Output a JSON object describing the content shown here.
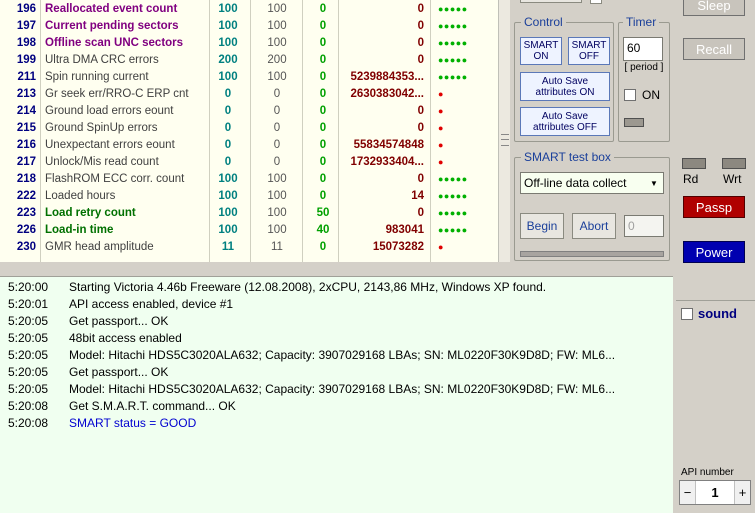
{
  "smart_rows": [
    {
      "id": "196",
      "name": "Reallocated event count",
      "val": "100",
      "worst": "100",
      "thr": "0",
      "raw": "0",
      "health": "●●●●●",
      "style": "purple",
      "hc": "green"
    },
    {
      "id": "197",
      "name": "Current pending sectors",
      "val": "100",
      "worst": "100",
      "thr": "0",
      "raw": "0",
      "health": "●●●●●",
      "style": "purple",
      "hc": "green"
    },
    {
      "id": "198",
      "name": "Offline scan UNC sectors",
      "val": "100",
      "worst": "100",
      "thr": "0",
      "raw": "0",
      "health": "●●●●●",
      "style": "purple",
      "hc": "green"
    },
    {
      "id": "199",
      "name": "Ultra DMA CRC errors",
      "val": "200",
      "worst": "200",
      "thr": "0",
      "raw": "0",
      "health": "●●●●●",
      "style": "gray",
      "hc": "green"
    },
    {
      "id": "211",
      "name": "Spin running current",
      "val": "100",
      "worst": "100",
      "thr": "0",
      "raw": "5239884353...",
      "health": "●●●●●",
      "style": "gray",
      "hc": "green"
    },
    {
      "id": "213",
      "name": "Gr seek err/RRO-C ERP cnt",
      "val": "0",
      "worst": "0",
      "thr": "0",
      "raw": "2630383042...",
      "health": "●",
      "style": "gray",
      "hc": "red"
    },
    {
      "id": "214",
      "name": "Ground load errors eount",
      "val": "0",
      "worst": "0",
      "thr": "0",
      "raw": "0",
      "health": "●",
      "style": "gray",
      "hc": "red"
    },
    {
      "id": "215",
      "name": "Ground SpinUp errors",
      "val": "0",
      "worst": "0",
      "thr": "0",
      "raw": "0",
      "health": "●",
      "style": "gray",
      "hc": "red"
    },
    {
      "id": "216",
      "name": "Unexpectant errors eount",
      "val": "0",
      "worst": "0",
      "thr": "0",
      "raw": "55834574848",
      "health": "●",
      "style": "gray",
      "hc": "red"
    },
    {
      "id": "217",
      "name": "Unlock/Mis read count",
      "val": "0",
      "worst": "0",
      "thr": "0",
      "raw": "1732933404...",
      "health": "●",
      "style": "gray",
      "hc": "red"
    },
    {
      "id": "218",
      "name": "FlashROM ECC corr. count",
      "val": "100",
      "worst": "100",
      "thr": "0",
      "raw": "0",
      "health": "●●●●●",
      "style": "gray",
      "hc": "green"
    },
    {
      "id": "222",
      "name": "Loaded hours",
      "val": "100",
      "worst": "100",
      "thr": "0",
      "raw": "14",
      "health": "●●●●●",
      "style": "gray",
      "hc": "green"
    },
    {
      "id": "223",
      "name": "Load retry count",
      "val": "100",
      "worst": "100",
      "thr": "50",
      "raw": "0",
      "health": "●●●●●",
      "style": "green",
      "hc": "green"
    },
    {
      "id": "226",
      "name": "Load-in time",
      "val": "100",
      "worst": "100",
      "thr": "40",
      "raw": "983041",
      "health": "●●●●●",
      "style": "green",
      "hc": "green"
    },
    {
      "id": "230",
      "name": "GMR head amplitude",
      "val": "11",
      "worst": "11",
      "thr": "0",
      "raw": "15073282",
      "health": "●",
      "style": "gray",
      "hc": "red"
    }
  ],
  "control": {
    "title": "Control",
    "smart_on": "SMART ON",
    "smart_off": "SMART OFF",
    "autosave_on": "Auto Save attributes ON",
    "autosave_off": "Auto Save attributes OFF"
  },
  "timer": {
    "title": "Timer",
    "value": "60",
    "period_label": "[ period ]",
    "on_label": "ON"
  },
  "test_box": {
    "title": "SMART test box",
    "selected": "Off-line data collect",
    "begin": "Begin",
    "abort": "Abort",
    "count": "0"
  },
  "right_panel": {
    "sleep": "Sleep",
    "recall": "Recall",
    "rd": "Rd",
    "wrt": "Wrt",
    "passp": "Passp",
    "power": "Power",
    "sound": "sound",
    "api_label": "API number",
    "api_value": "1",
    "minus": "−",
    "plus": "+"
  },
  "log": [
    {
      "time": "5:20:00",
      "msg": "Starting Victoria 4.46b Freeware (12.08.2008), 2xCPU, 2143,86 MHz, Windows XP found.",
      "color": "black"
    },
    {
      "time": "5:20:01",
      "msg": "API access enabled, device #1",
      "color": "black"
    },
    {
      "time": "5:20:05",
      "msg": "Get passport... OK",
      "color": "black"
    },
    {
      "time": "5:20:05",
      "msg": "48bit access enabled",
      "color": "black"
    },
    {
      "time": "5:20:05",
      "msg": "Model: Hitachi HDS5C3020ALA632; Capacity: 3907029168 LBAs; SN: ML0220F30K9D8D; FW: ML6...",
      "color": "black"
    },
    {
      "time": "5:20:05",
      "msg": "Get passport... OK",
      "color": "black"
    },
    {
      "time": "5:20:05",
      "msg": "Model: Hitachi HDS5C3020ALA632; Capacity: 3907029168 LBAs; SN: ML0220F30K9D8D; FW: ML6...",
      "color": "black"
    },
    {
      "time": "5:20:08",
      "msg": "Get S.M.A.R.T. command... OK",
      "color": "black"
    },
    {
      "time": "5:20:08",
      "msg": "SMART status = GOOD",
      "color": "blue"
    }
  ]
}
